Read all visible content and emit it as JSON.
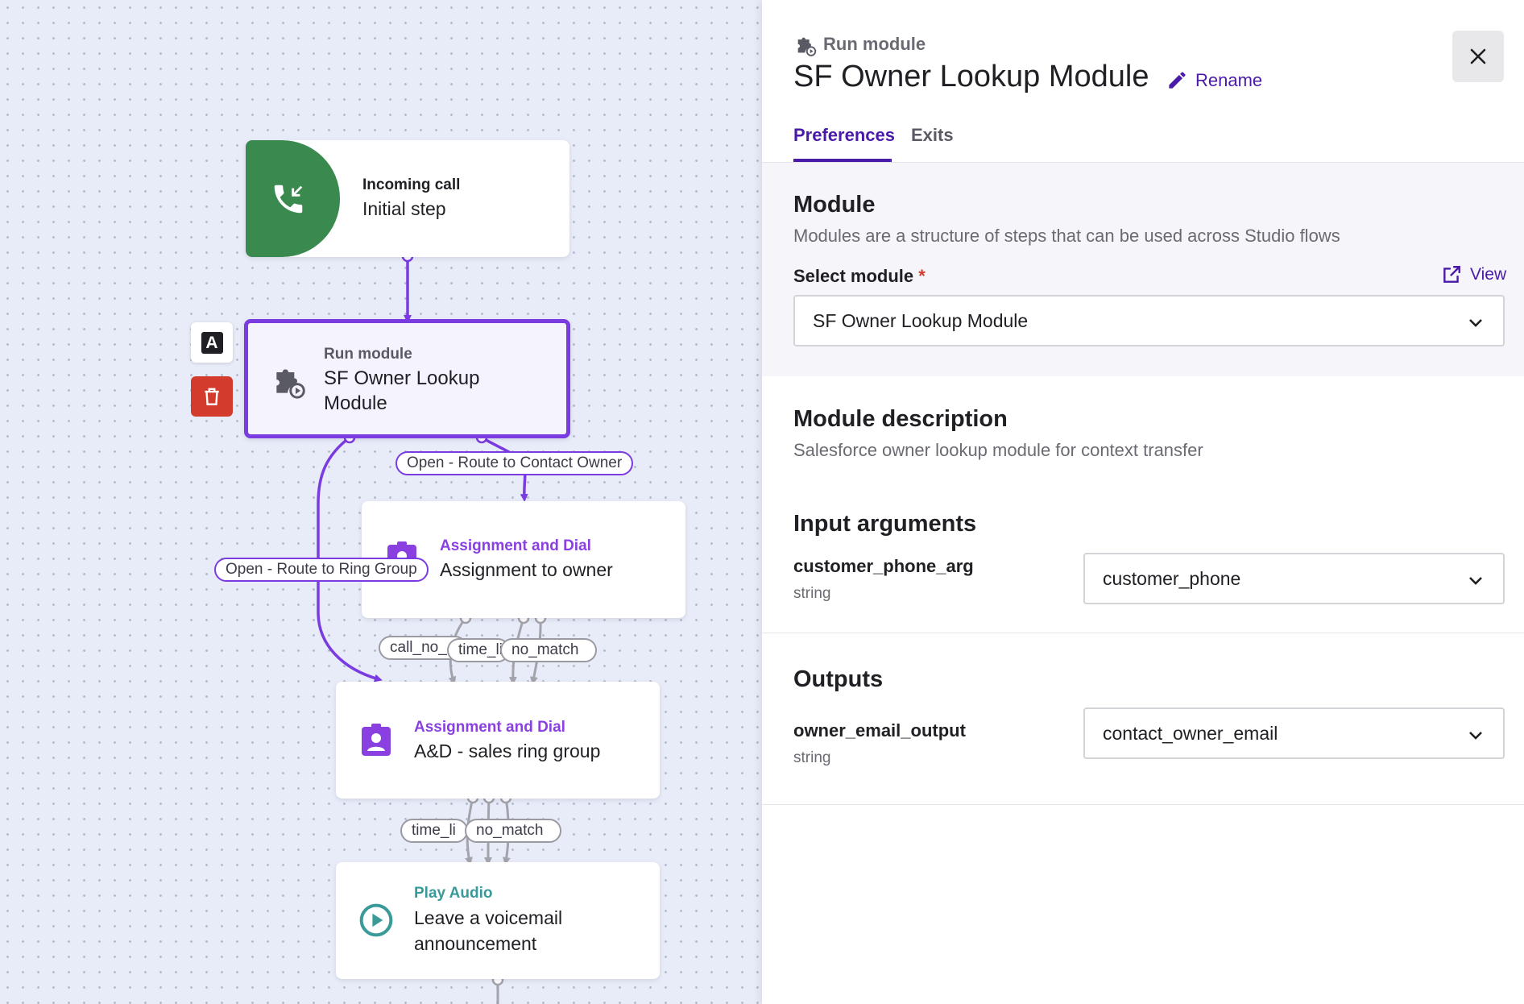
{
  "canvas": {
    "nodes": {
      "incoming": {
        "kicker": "Incoming call",
        "title": "Initial step"
      },
      "run_module": {
        "kicker": "Run module",
        "title_line1": "SF Owner Lookup",
        "title_line2": "Module"
      },
      "assign_owner": {
        "kicker": "Assignment and Dial",
        "title": "Assignment to owner"
      },
      "assign_ring": {
        "kicker": "Assignment and Dial",
        "title": "A&D - sales ring group"
      },
      "play_audio": {
        "kicker": "Play Audio",
        "title_line1": "Leave a voicemail",
        "title_line2": "announcement"
      }
    },
    "edge_labels": {
      "contact_owner": "Open - Route to Contact Owner",
      "ring_group": "Open - Route to Ring Group",
      "call_no": "call_no_",
      "time_li_1": "time_li",
      "no_match_1": "no_match",
      "time_li_2": "time_li",
      "no_match_2": "no_match"
    },
    "side_buttons": {
      "rename_letter": "A"
    }
  },
  "panel": {
    "kicker": "Run module",
    "title": "SF Owner Lookup Module",
    "rename_label": "Rename",
    "tabs": [
      {
        "label": "Preferences",
        "active": true
      },
      {
        "label": "Exits",
        "active": false
      }
    ],
    "module_section": {
      "title": "Module",
      "description": "Modules are a structure of steps that can be used across Studio flows",
      "select_label": "Select module",
      "required_mark": "*",
      "view_label": "View",
      "selected_value": "SF Owner Lookup Module"
    },
    "description_section": {
      "title": "Module description",
      "text": "Salesforce owner lookup module for context transfer"
    },
    "inputs_section": {
      "title": "Input arguments",
      "args": [
        {
          "name": "customer_phone_arg",
          "type": "string",
          "value": "customer_phone"
        }
      ]
    },
    "outputs_section": {
      "title": "Outputs",
      "args": [
        {
          "name": "owner_email_output",
          "type": "string",
          "value": "contact_owner_email"
        }
      ]
    }
  },
  "colors": {
    "accent_purple": "#7a3be0",
    "tab_active": "#4a1aa8",
    "incoming_green": "#3a8a4f",
    "delete_red": "#d33b2c",
    "play_teal": "#3a9a9a"
  }
}
